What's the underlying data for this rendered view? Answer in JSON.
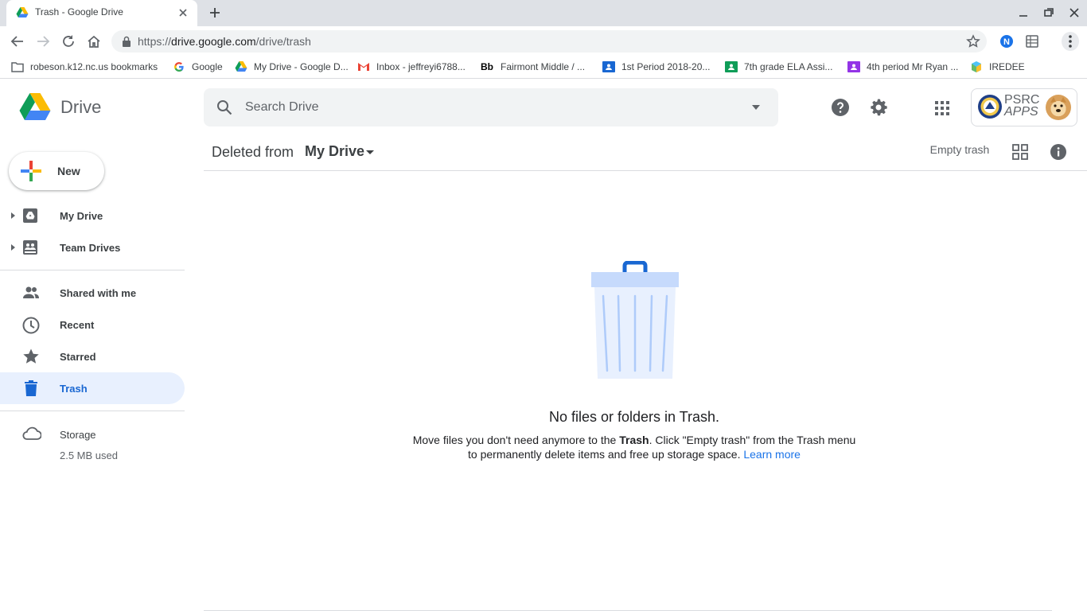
{
  "browser": {
    "tab_title": "Trash - Google Drive",
    "url_prefix": "https://",
    "url_host": "drive.google.com",
    "url_path": "/drive/trash",
    "extension_n_label": "N"
  },
  "bookmarks": [
    {
      "label": "robeson.k12.nc.us bookmarks",
      "icon": "folder-icon"
    },
    {
      "label": "Google",
      "icon": "google-g-icon"
    },
    {
      "label": "My Drive - Google D...",
      "icon": "drive-icon"
    },
    {
      "label": "Inbox - jeffreyi6788...",
      "icon": "gmail-icon"
    },
    {
      "label": "Fairmont Middle / ...",
      "icon": "blackboard-icon",
      "icon_text": "Bb"
    },
    {
      "label": "1st Period 2018-20...",
      "icon": "classroom-blue-icon"
    },
    {
      "label": "7th grade ELA Assi...",
      "icon": "classroom-green-icon"
    },
    {
      "label": "4th period Mr Ryan ...",
      "icon": "classroom-purple-icon"
    },
    {
      "label": "IREDEE",
      "icon": "cube-icon"
    }
  ],
  "header": {
    "app_name": "Drive",
    "search_placeholder": "Search Drive",
    "org_line1": "PSRC",
    "org_line2": "APPS"
  },
  "sidebar": {
    "new_label": "New",
    "items": [
      {
        "label": "My Drive",
        "icon": "my-drive-icon"
      },
      {
        "label": "Team Drives",
        "icon": "team-drives-icon"
      },
      {
        "label": "Shared with me",
        "icon": "people-icon"
      },
      {
        "label": "Recent",
        "icon": "clock-icon"
      },
      {
        "label": "Starred",
        "icon": "star-icon"
      },
      {
        "label": "Trash",
        "icon": "trash-icon",
        "selected": true
      }
    ],
    "storage_label": "Storage",
    "storage_used": "2.5 MB used"
  },
  "main": {
    "deleted_from": "Deleted from",
    "location": "My Drive",
    "empty_trash_label": "Empty trash",
    "empty_title": "No files or folders in Trash.",
    "desc_part1": "Move files you don't need anymore to the ",
    "desc_bold": "Trash",
    "desc_part2": ". Click \"Empty trash\" from the Trash menu",
    "desc_line2": "to permanently delete items and free up storage space. ",
    "learn_more": "Learn more"
  },
  "colors": {
    "accent": "#1a73e8",
    "selected_bg": "#e8f0fe",
    "selected_text": "#1967d2"
  }
}
